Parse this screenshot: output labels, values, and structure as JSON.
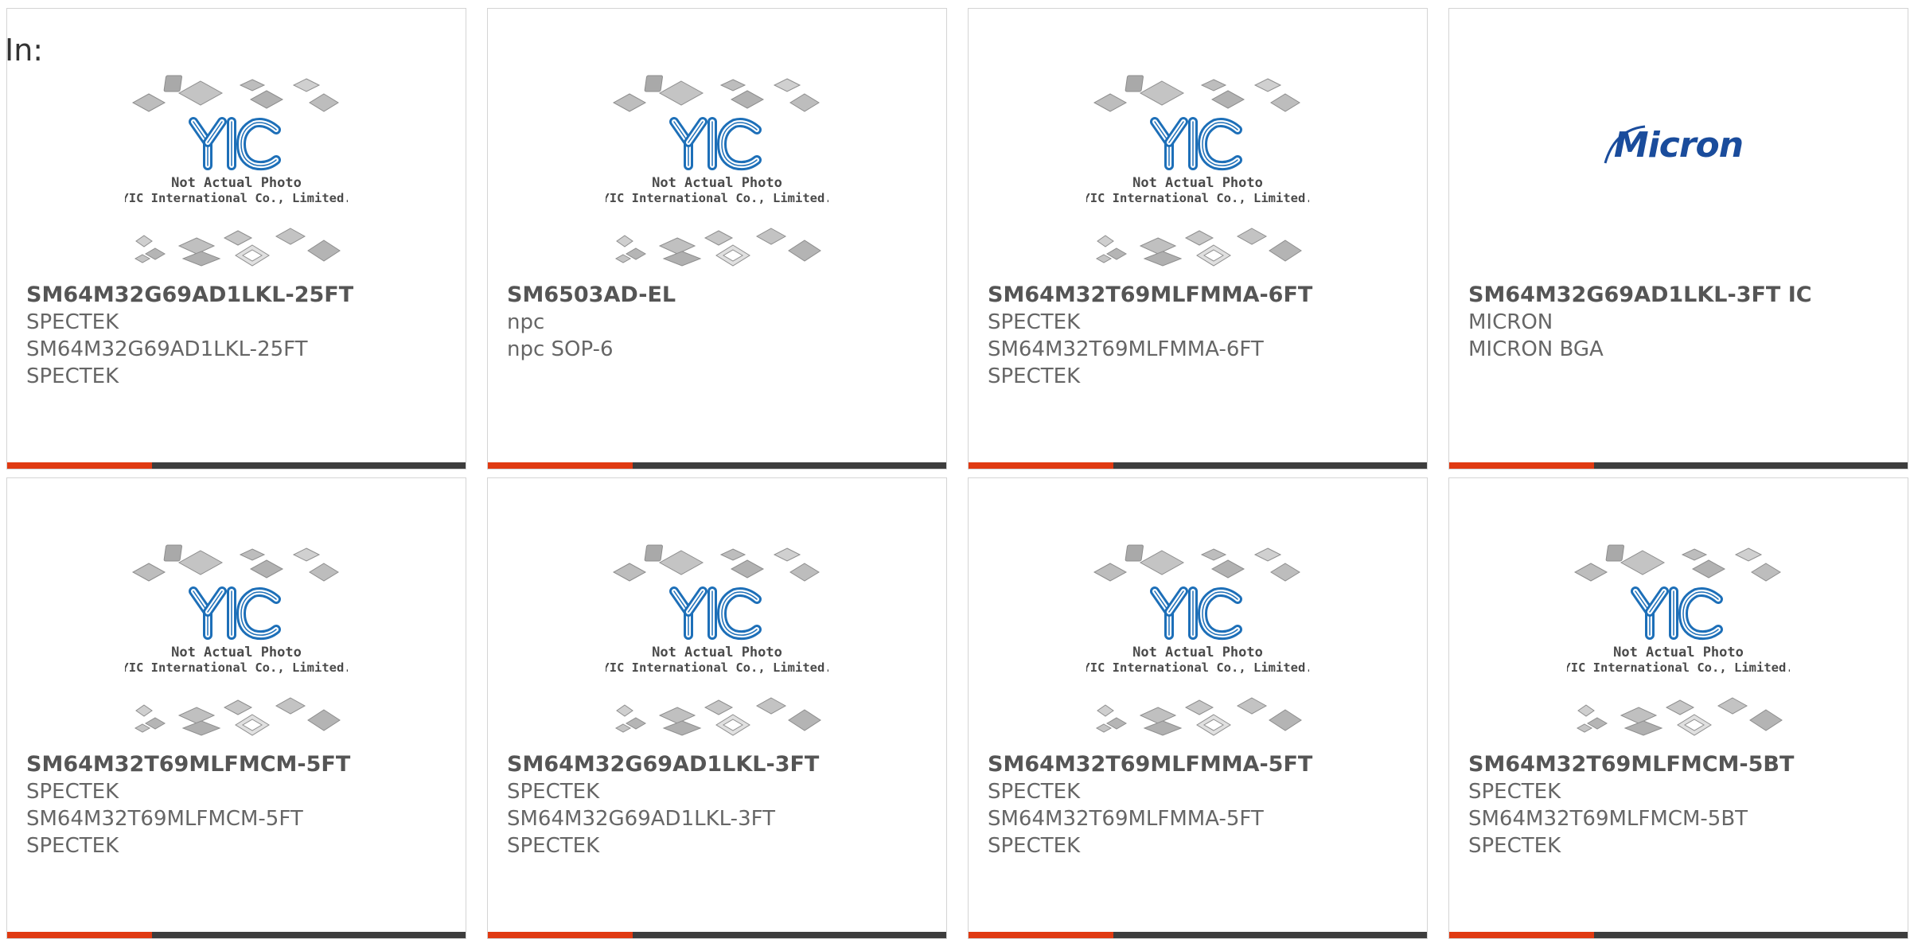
{
  "header": {
    "label": "In:"
  },
  "placeholder": {
    "caption_line1": "Not Actual Photo",
    "caption_line2": "YIC International Co., Limited."
  },
  "brand_logos": {
    "micron": "Micron"
  },
  "colors": {
    "accent": "#e03a12",
    "bar": "#3d3d3d",
    "logo_blue": "#1d6fb8",
    "micron_blue": "#1a4c9c"
  },
  "cards": [
    {
      "name": "SM64M32G69AD1LKL-25FT",
      "lines": [
        "SPECTEK",
        "SM64M32G69AD1LKL-25FT",
        "SPECTEK"
      ],
      "image": "placeholder"
    },
    {
      "name": "SM6503AD-EL",
      "lines": [
        "npc",
        "npc SOP-6",
        ""
      ],
      "image": "placeholder"
    },
    {
      "name": "SM64M32T69MLFMMA-6FT",
      "lines": [
        "SPECTEK",
        "SM64M32T69MLFMMA-6FT",
        "SPECTEK"
      ],
      "image": "placeholder"
    },
    {
      "name": "SM64M32G69AD1LKL-3FT IC",
      "lines": [
        "MICRON",
        "MICRON BGA",
        ""
      ],
      "image": "micron-logo"
    },
    {
      "name": "SM64M32T69MLFMCM-5FT",
      "lines": [
        "SPECTEK",
        "SM64M32T69MLFMCM-5FT",
        "SPECTEK"
      ],
      "image": "placeholder"
    },
    {
      "name": "SM64M32G69AD1LKL-3FT",
      "lines": [
        "SPECTEK",
        "SM64M32G69AD1LKL-3FT",
        "SPECTEK"
      ],
      "image": "placeholder"
    },
    {
      "name": "SM64M32T69MLFMMA-5FT",
      "lines": [
        "SPECTEK",
        "SM64M32T69MLFMMA-5FT",
        "SPECTEK"
      ],
      "image": "placeholder"
    },
    {
      "name": "SM64M32T69MLFMCM-5BT",
      "lines": [
        "SPECTEK",
        "SM64M32T69MLFMCM-5BT",
        "SPECTEK"
      ],
      "image": "placeholder"
    }
  ]
}
